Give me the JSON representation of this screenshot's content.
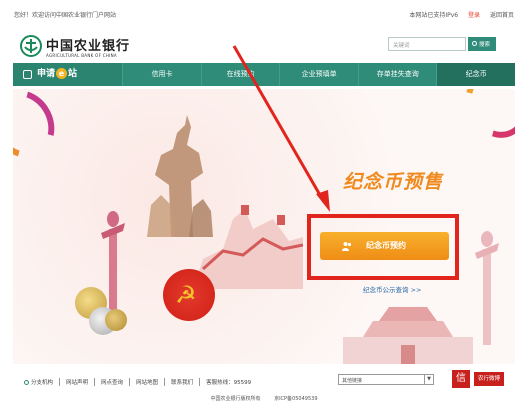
{
  "topbar": {
    "welcome": "您好！欢迎访问中国农业银行门户网站",
    "ipv6": "本网站已支持IPv6",
    "login": "登录",
    "home": "返回首页"
  },
  "logo": {
    "cn": "中国农业银行",
    "en": "AGRICULTURAL BANK OF CHINA"
  },
  "search": {
    "placeholder": "关键词",
    "button": "搜索"
  },
  "nav": {
    "brand": [
      "申请",
      "e",
      "站"
    ],
    "items": [
      "信用卡",
      "在线预约",
      "企业预填单",
      "存单挂失查询",
      "纪念币"
    ]
  },
  "banner": {
    "headline": "纪念币预售",
    "cta": "纪念币预约",
    "query_link": "纪念币公示查询 >>"
  },
  "footer": {
    "links": [
      "分支机构",
      "网站声明",
      "网点查询",
      "网站地图",
      "联系我们",
      "客服热线：95599"
    ],
    "select": "其他链接",
    "weibo_icon": "信",
    "weibo": "农行微博",
    "copyright": "中国农业银行版权所有",
    "icp": "京ICP备05049539"
  },
  "colors": {
    "nav": "#2f8c79",
    "cta": "#ef8d16",
    "highlight": "#e1241c",
    "headline": "#f08a1e"
  }
}
